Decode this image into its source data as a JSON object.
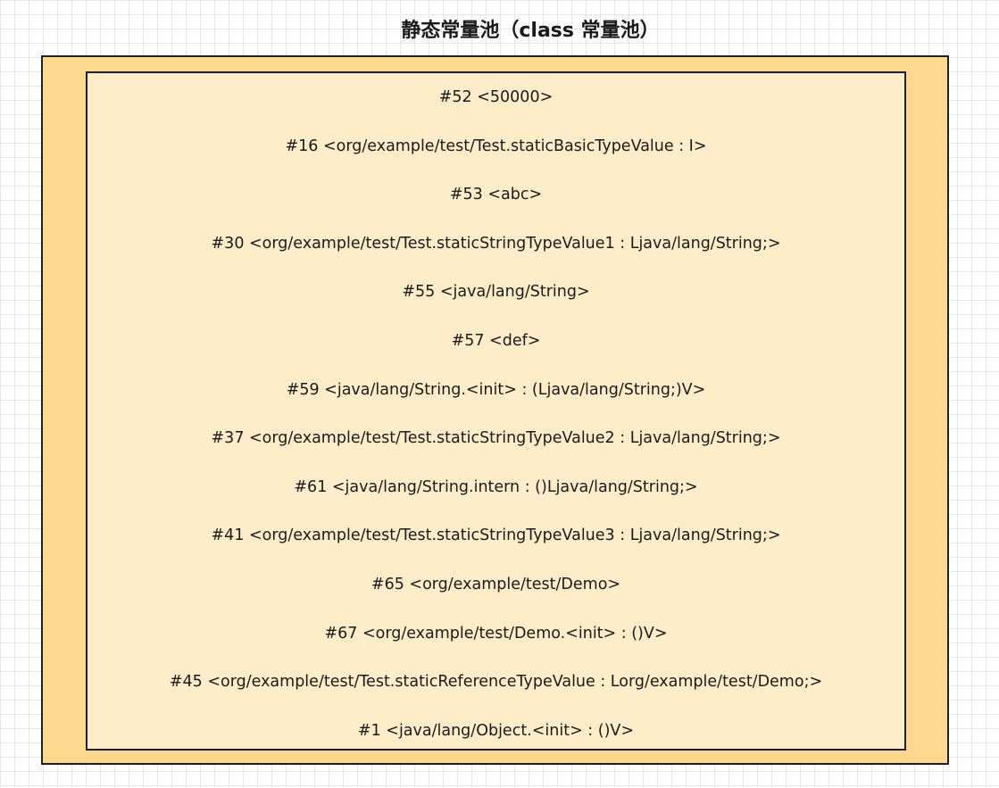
{
  "title": "静态常量池（class 常量池）",
  "entries": [
    "#52 <50000>",
    "#16  <org/example/test/Test.staticBasicTypeValue : I>",
    "#53  <abc>",
    "#30 <org/example/test/Test.staticStringTypeValue1 : Ljava/lang/String;>",
    "#55 <java/lang/String>",
    "#57  <def>",
    "#59 <java/lang/String.<init> : (Ljava/lang/String;)V>",
    "#37 <org/example/test/Test.staticStringTypeValue2 : Ljava/lang/String;>",
    "#61  <java/lang/String.intern : ()Ljava/lang/String;>",
    "#41 <org/example/test/Test.staticStringTypeValue3 : Ljava/lang/String;>",
    "#65 <org/example/test/Demo>",
    "#67  <org/example/test/Demo.<init> : ()V>",
    "#45 <org/example/test/Test.staticReferenceTypeValue : Lorg/example/test/Demo;>",
    "#1  <java/lang/Object.<init> : ()V>"
  ]
}
